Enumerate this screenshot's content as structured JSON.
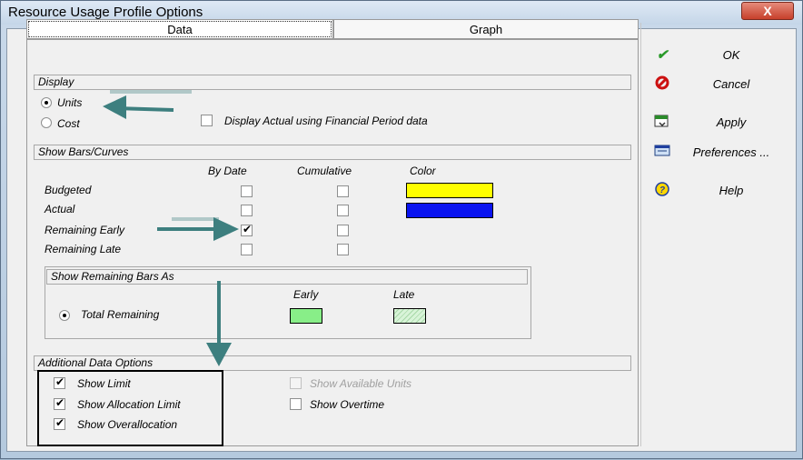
{
  "window": {
    "title": "Resource Usage Profile Options",
    "close_glyph": "X"
  },
  "tabs": {
    "data": "Data",
    "graph": "Graph"
  },
  "display": {
    "header": "Display",
    "units_label": "Units",
    "cost_label": "Cost",
    "financial_label": "Display Actual using Financial Period data",
    "selected": "Units",
    "financial_checked": false
  },
  "bars": {
    "header": "Show Bars/Curves",
    "col_by_date": "By Date",
    "col_cumulative": "Cumulative",
    "col_color": "Color",
    "rows": [
      {
        "label": "Budgeted",
        "by_date": false,
        "cumulative": false,
        "color": "#ffff00"
      },
      {
        "label": "Actual",
        "by_date": false,
        "cumulative": false,
        "color": "#0000ff"
      },
      {
        "label": "Remaining Early",
        "by_date": true,
        "cumulative": false
      },
      {
        "label": "Remaining Late",
        "by_date": false,
        "cumulative": false
      }
    ]
  },
  "remaining": {
    "header": "Show Remaining Bars As",
    "early_label": "Early",
    "late_label": "Late",
    "option_label": "Total Remaining",
    "early_color": "#88ee88",
    "late_color": "#d8f4d8"
  },
  "additional": {
    "header": "Additional Data Options",
    "show_limit": "Show Limit",
    "show_allocation_limit": "Show Allocation Limit",
    "show_overallocation": "Show Overallocation",
    "show_available_units": "Show Available Units",
    "show_overtime": "Show Overtime"
  },
  "buttons": {
    "ok": "OK",
    "cancel": "Cancel",
    "apply": "Apply",
    "preferences": "Preferences ...",
    "help": "Help"
  },
  "colors": {
    "arrow": "#3d7f7f",
    "accent_green": "#2a9a2a",
    "cancel_red": "#cc1111"
  },
  "icons": [
    "checkmark-icon",
    "cancel-icon",
    "apply-icon",
    "preferences-icon",
    "help-icon",
    "close-icon"
  ]
}
